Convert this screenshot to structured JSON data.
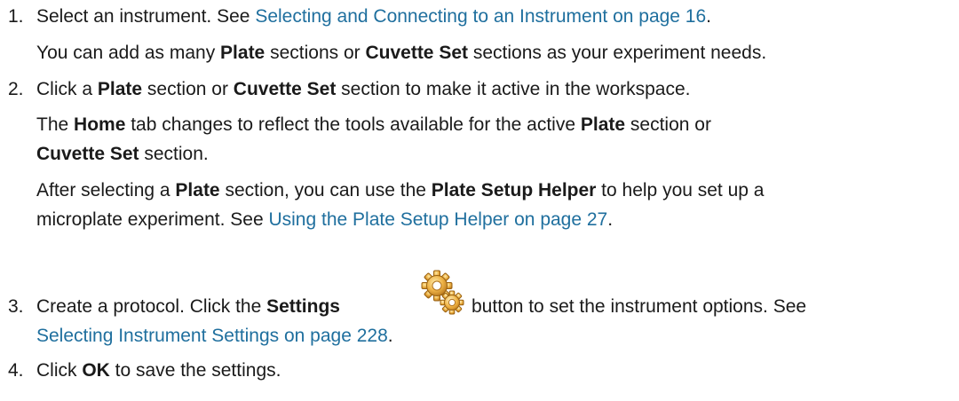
{
  "steps": [
    {
      "number": "1.",
      "line1": {
        "pre": "Select an instrument. See ",
        "link": "Selecting and Connecting to an Instrument on page 16",
        "post": "."
      },
      "line2": {
        "a": "You can add as many ",
        "b1": "Plate",
        "c": " sections or ",
        "b2": "Cuvette Set",
        "d": " sections as your experiment needs."
      }
    },
    {
      "number": "2.",
      "line1": {
        "a": "Click a ",
        "b1": "Plate",
        "c": " section or ",
        "b2": "Cuvette Set",
        "d": " section to make it active in the workspace."
      },
      "line2": {
        "a": "The ",
        "b1": "Home",
        "c": " tab changes to reflect the tools available for the active ",
        "b2": "Plate",
        "d": " section or"
      },
      "line3": {
        "b1": "Cuvette Set",
        "a": " section."
      },
      "line4": {
        "a": "After selecting a ",
        "b1": "Plate",
        "c": " section, you can use the ",
        "b2": "Plate Setup Helper",
        "d": " to help you set up a"
      },
      "line5": {
        "pre": "microplate experiment. See ",
        "link": "Using the Plate Setup Helper on page 27",
        "post": "."
      }
    },
    {
      "number": "3.",
      "line1": {
        "a": "Create a protocol. Click the ",
        "b1": "Settings",
        "c": " button to set the instrument options. See"
      },
      "line2": {
        "link": "Selecting Instrument Settings on page 228",
        "post": "."
      },
      "icon": "settings-gear-icon"
    },
    {
      "number": "4.",
      "line1": {
        "a": "Click ",
        "b1": "OK",
        "c": " to save the settings."
      }
    }
  ],
  "colors": {
    "link": "#1f6f9e",
    "text": "#1a1a1a",
    "gear_outer": "#e8a93c",
    "gear_inner": "#f3c96a"
  }
}
